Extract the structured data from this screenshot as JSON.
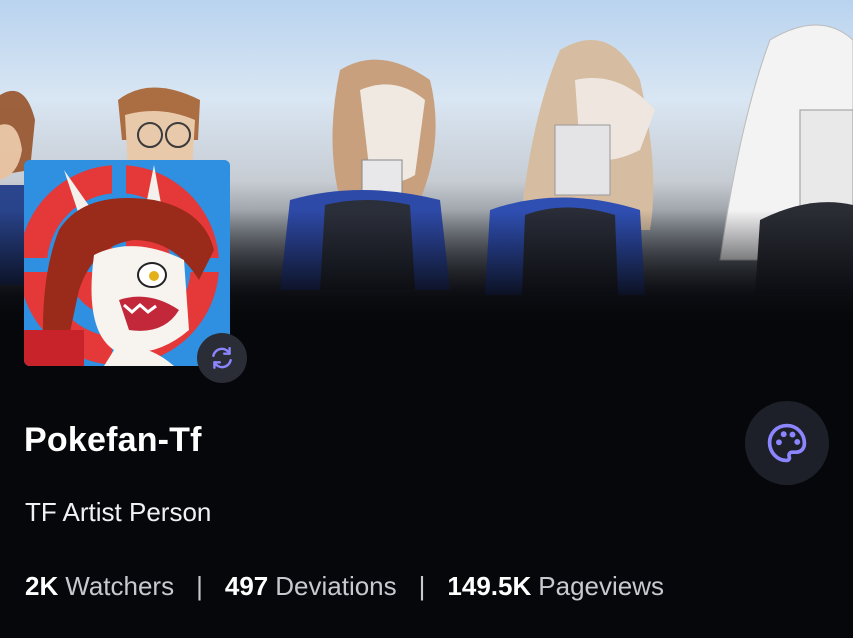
{
  "profile": {
    "username": "Pokefan-Tf",
    "tagline": "TF Artist Person"
  },
  "stats": [
    {
      "value": "2K",
      "label": "Watchers"
    },
    {
      "value": "497",
      "label": "Deviations"
    },
    {
      "value": "149.5K",
      "label": "Pageviews"
    }
  ],
  "stats_separator": "|",
  "icons": {
    "change_avatar": "refresh-icon",
    "theme": "palette-icon"
  },
  "colors": {
    "accent": "#8b86ff",
    "background": "#06070b",
    "button_bg": "#1e2029"
  }
}
